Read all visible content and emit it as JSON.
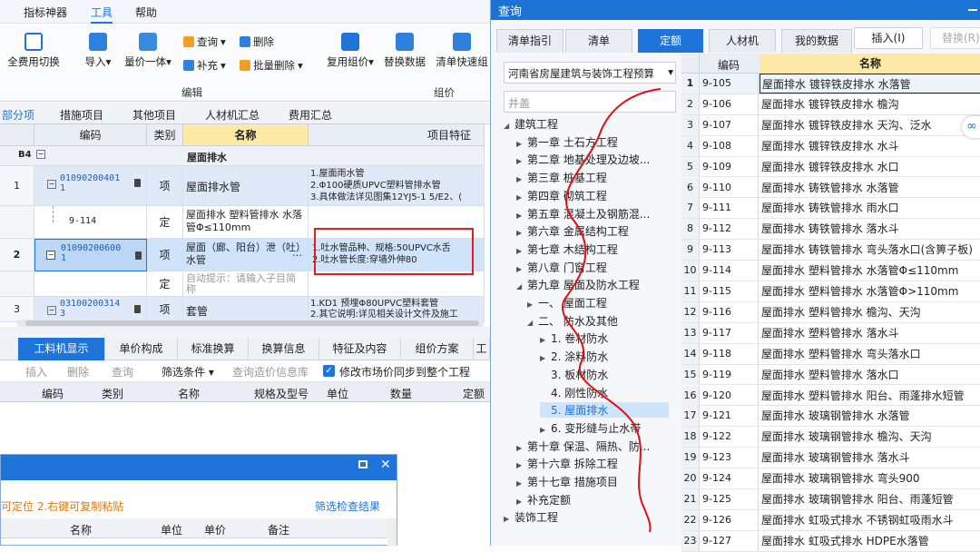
{
  "menubar": {
    "items": [
      "指标神器",
      "工具",
      "帮助"
    ],
    "active": "工具"
  },
  "ribbon": {
    "buttons": [
      {
        "label": "全费用切换",
        "icon": "fee-switch-icon"
      },
      {
        "label": "导入",
        "icon": "import-icon"
      },
      {
        "label": "量价一体",
        "icon": "quantity-price-icon"
      },
      {
        "label": "复用组价",
        "icon": "reuse-pricing-icon"
      },
      {
        "label": "替换数据",
        "icon": "replace-data-icon"
      },
      {
        "label": "清单快速组",
        "icon": "quick-group-icon"
      }
    ],
    "small": {
      "query": "查询",
      "delete": "删除",
      "supplement": "补充",
      "batch_delete": "批量删除"
    },
    "group_labels": {
      "edit": "编辑",
      "group": "组价"
    }
  },
  "section_tabs": [
    "部分项",
    "措施项目",
    "其他项目",
    "人材机汇总",
    "费用汇总"
  ],
  "grid": {
    "headers": {
      "code": "编码",
      "type": "类别",
      "name": "名称",
      "feature": "项目特征"
    },
    "section_row": {
      "id": "B4",
      "name": "屋面排水"
    },
    "rows": [
      {
        "num": "1",
        "code": "01090200401\n1",
        "type": "项",
        "name": "屋面排水管",
        "feature": "1.屋面雨水管\n2.Φ100硬质UPVC塑料管排水管\n3.具体做法详见图集12YJ5-1 5/E2、("
      },
      {
        "num": "",
        "code": "9-114",
        "type": "定",
        "name": "屋面排水 塑料管排水 水落管Φ≤110mm",
        "feature": ""
      },
      {
        "num": "2",
        "code": "01090200600\n1",
        "type": "项",
        "name": "屋面（廊、阳台）泄（吐）水管",
        "feature": "1.吐水管品种、规格:50UPVC水舌\n2.吐水管长度:穿墙外伸80"
      },
      {
        "num": "",
        "code": "",
        "type": "定",
        "name": "自动提示：请输入子目简称",
        "feature": ""
      },
      {
        "num": "3",
        "code": "03100200314\n3",
        "type": "项",
        "name": "套管",
        "feature": "1.KD1 预埋Φ80UPVC塑料套管\n2.其它说明:详见相关设计文件及施工"
      }
    ]
  },
  "bottom_tabs": [
    "工料机显示",
    "单价构成",
    "标准换算",
    "换算信息",
    "特征及内容",
    "组价方案",
    "工"
  ],
  "bottom_toolbar": {
    "insert": "插入",
    "delete": "删除",
    "query": "查询",
    "filter": "筛选条件",
    "query_price": "查询造价信息库",
    "checkbox_label": "修改市场价同步到整个工程"
  },
  "bottom_headers": [
    "编码",
    "类别",
    "名称",
    "规格及型号",
    "单位",
    "数量",
    "定额"
  ],
  "dialog": {
    "hint": "可定位 2.右键可复制粘贴",
    "filter_link": "筛选检查结果",
    "headers": [
      "名称",
      "单位",
      "单价",
      "备注"
    ]
  },
  "query": {
    "title": "查询",
    "tabs": [
      "清单指引",
      "清单",
      "定额",
      "人材机",
      "我的数据"
    ],
    "active_tab": "定额",
    "insert_button": "插入(I)",
    "replace_button": "替换(R)",
    "library": "河南省房屋建筑与装饰工程预算",
    "search_value": "井盖",
    "tree": [
      {
        "level": 0,
        "label": "建筑工程",
        "arrow": "down"
      },
      {
        "level": 1,
        "label": "第一章 土石方工程",
        "arrow": "right"
      },
      {
        "level": 1,
        "label": "第二章 地基处理及边坡...",
        "arrow": "right"
      },
      {
        "level": 1,
        "label": "第三章 桩基工程",
        "arrow": "right"
      },
      {
        "level": 1,
        "label": "第四章 砌筑工程",
        "arrow": "right"
      },
      {
        "level": 1,
        "label": "第五章 混凝土及钢筋混...",
        "arrow": "right"
      },
      {
        "level": 1,
        "label": "第六章 金属结构工程",
        "arrow": "right"
      },
      {
        "level": 1,
        "label": "第七章 木结构工程",
        "arrow": "right"
      },
      {
        "level": 1,
        "label": "第八章 门窗工程",
        "arrow": "right"
      },
      {
        "level": 1,
        "label": "第九章 屋面及防水工程",
        "arrow": "down"
      },
      {
        "level": 2,
        "label": "一、 屋面工程",
        "arrow": "right"
      },
      {
        "level": 2,
        "label": "二、 防水及其他",
        "arrow": "down"
      },
      {
        "level": 3,
        "label": "1. 卷材防水",
        "arrow": "right"
      },
      {
        "level": 3,
        "label": "2. 涂料防水",
        "arrow": "right"
      },
      {
        "level": 3,
        "label": "3. 板材防水",
        "arrow": ""
      },
      {
        "level": 3,
        "label": "4. 刚性防水",
        "arrow": ""
      },
      {
        "level": 3,
        "label": "5. 屋面排水",
        "arrow": "",
        "selected": true
      },
      {
        "level": 3,
        "label": "6. 变形缝与止水带",
        "arrow": "right"
      },
      {
        "level": 1,
        "label": "第十章 保温、隔热、防...",
        "arrow": "right"
      },
      {
        "level": 1,
        "label": "第十六章 拆除工程",
        "arrow": "right"
      },
      {
        "level": 1,
        "label": "第十七章 措施项目",
        "arrow": "right"
      },
      {
        "level": 1,
        "label": "补充定额",
        "arrow": "right"
      },
      {
        "level": 0,
        "label": "装饰工程",
        "arrow": "right"
      }
    ],
    "table_headers": {
      "code": "编码",
      "name": "名称"
    },
    "rows": [
      {
        "num": "1",
        "code": "9-105",
        "name": "屋面排水 镀锌铁皮排水 水落管"
      },
      {
        "num": "2",
        "code": "9-106",
        "name": "屋面排水 镀锌铁皮排水 檐沟"
      },
      {
        "num": "3",
        "code": "9-107",
        "name": "屋面排水 镀锌铁皮排水 天沟、泛水"
      },
      {
        "num": "4",
        "code": "9-108",
        "name": "屋面排水 镀锌铁皮排水 水斗"
      },
      {
        "num": "5",
        "code": "9-109",
        "name": "屋面排水 镀锌铁皮排水 水口"
      },
      {
        "num": "6",
        "code": "9-110",
        "name": "屋面排水 铸铁管排水 水落管"
      },
      {
        "num": "7",
        "code": "9-111",
        "name": "屋面排水 铸铁管排水 雨水口"
      },
      {
        "num": "8",
        "code": "9-112",
        "name": "屋面排水 铸铁管排水 落水斗"
      },
      {
        "num": "9",
        "code": "9-113",
        "name": "屋面排水 铸铁管排水 弯头落水口(含箅子板)"
      },
      {
        "num": "10",
        "code": "9-114",
        "name": "屋面排水 塑料管排水 水落管Φ≤110mm"
      },
      {
        "num": "11",
        "code": "9-115",
        "name": "屋面排水 塑料管排水 水落管Φ>110mm"
      },
      {
        "num": "12",
        "code": "9-116",
        "name": "屋面排水 塑料管排水 檐沟、天沟"
      },
      {
        "num": "13",
        "code": "9-117",
        "name": "屋面排水 塑料管排水 落水斗"
      },
      {
        "num": "14",
        "code": "9-118",
        "name": "屋面排水 塑料管排水 弯头落水口"
      },
      {
        "num": "15",
        "code": "9-119",
        "name": "屋面排水 塑料管排水 落水口"
      },
      {
        "num": "16",
        "code": "9-120",
        "name": "屋面排水 塑料管排水 阳台、雨蓬排水短管"
      },
      {
        "num": "17",
        "code": "9-121",
        "name": "屋面排水 玻璃钢管排水 水落管"
      },
      {
        "num": "18",
        "code": "9-122",
        "name": "屋面排水 玻璃钢管排水 檐沟、天沟"
      },
      {
        "num": "19",
        "code": "9-123",
        "name": "屋面排水 玻璃钢管排水 落水斗"
      },
      {
        "num": "20",
        "code": "9-124",
        "name": "屋面排水 玻璃钢管排水 弯头900"
      },
      {
        "num": "21",
        "code": "9-125",
        "name": "屋面排水 玻璃钢管排水 阳台、雨蓬短管"
      },
      {
        "num": "22",
        "code": "9-126",
        "name": "屋面排水 虹吸式排水 不锈钢虹吸雨水斗"
      },
      {
        "num": "23",
        "code": "9-127",
        "name": "屋面排水 虹吸式排水 HDPE水落管"
      }
    ]
  },
  "colors": {
    "accent": "#1e74d8",
    "highlight_box": "#e02020",
    "annotation_line": "#e01010",
    "selected_row": "#cfe3fb"
  }
}
